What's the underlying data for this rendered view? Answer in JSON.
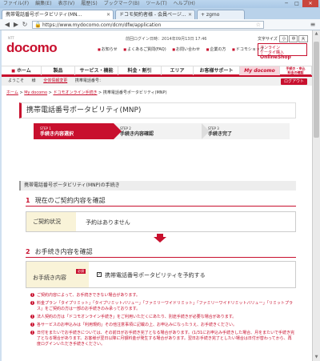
{
  "browser": {
    "menubar": [
      "ファイル(F)",
      "編集(E)",
      "表示(V)",
      "履歴(S)",
      "ブックマーク(B)",
      "ツール(T)",
      "ヘルプ(H)"
    ],
    "tabs": [
      "携帯電話番号ポータビリティ(MN...",
      "ドコモ契約者様 - 会員ページ...",
      "+ zgmo"
    ],
    "url": "https://www.mydocomo.com/dcm/dfw/application",
    "controls": {
      "minimize": "─",
      "maximize": "□",
      "close": "✕"
    }
  },
  "header": {
    "logo_sub": "NTT",
    "logo": "docomo",
    "login_time": "前回ログイン日時：2014年09月13日 17:46",
    "font_size_label": "文字サイズ",
    "font_sizes": [
      "小",
      "中",
      "大"
    ],
    "links": [
      "お知らせ",
      "よくあるご質問(FAQ)",
      "お問い合わせ",
      "企業の方",
      "ドコモショップ"
    ],
    "onlineshop": {
      "line1": "オンライン",
      "line2": "ケータイ購入",
      "brand": "OnlineShop"
    }
  },
  "gnav": {
    "home": "ホーム",
    "items": [
      "製品",
      "サービス・機能",
      "料金・割引",
      "エリア",
      "お客様サポート"
    ],
    "mydocomo": "My docomo",
    "side": "手続き・申込\n料金の確認"
  },
  "subnav": {
    "greeting": "ようこそ",
    "name_suffix": "様",
    "account_link": "全体情報変更",
    "phone_label": "携帯電話番号：",
    "logout": "ログアウト"
  },
  "breadcrumb": [
    "ホーム",
    "My docomo",
    "ドコモオンライン手続き",
    "携帯電話番号ポータビリティ(MNP)"
  ],
  "page_title": "携帯電話番号ポータビリティ(MNP)",
  "steps": [
    {
      "num": "STEP 1",
      "label": "手続き内容選択"
    },
    {
      "num": "STEP 2",
      "label": "手続き内容確認"
    },
    {
      "num": "STEP 3",
      "label": "手続き完了"
    }
  ],
  "section_bar": "携帯電話番号ポータビリティ(MNP)の手続き",
  "sec1": {
    "num": "1",
    "title": "現在のご契約内容を確認",
    "label": "ご契約状況",
    "value": "予約はありません"
  },
  "sec2": {
    "num": "2",
    "title": "お手続き内容を確認",
    "required": "必須",
    "label": "お手続き内容",
    "option": "携帯電話番号ポータビリティを予約する",
    "checked": "✓"
  },
  "notes": [
    "ご契約内容によって、お手続きできない場合があります。",
    "料金プラン「タイプリミット」「タイプリミットバリュー」「ファミリーワイドリミット」「ファミリーワイドリミットバリュー」「リミットプラス」をご契約の方は一部のお手続きのみ承っております。",
    "法人契約の方は「ドコモオンライン手続き」をご利用いただくにあたり、別途手続きが必要な場合があります。",
    "各サービスのお申込みは「利用規約」その他注意事項に記載の上、お申込みになったうえ、お手続きください。",
    "日付をまたいでお手続きについては、その前日がお手続き完了となる場合があります。(1/31にお申込み手続きした場合、月をまたいで手続き完了となる場合があります。お客様が翌日以降に月額料金が発生する場合があります。翌日お手続き完了としたい場合は日付が替わってから、再度ログインいただき手続きください。"
  ]
}
